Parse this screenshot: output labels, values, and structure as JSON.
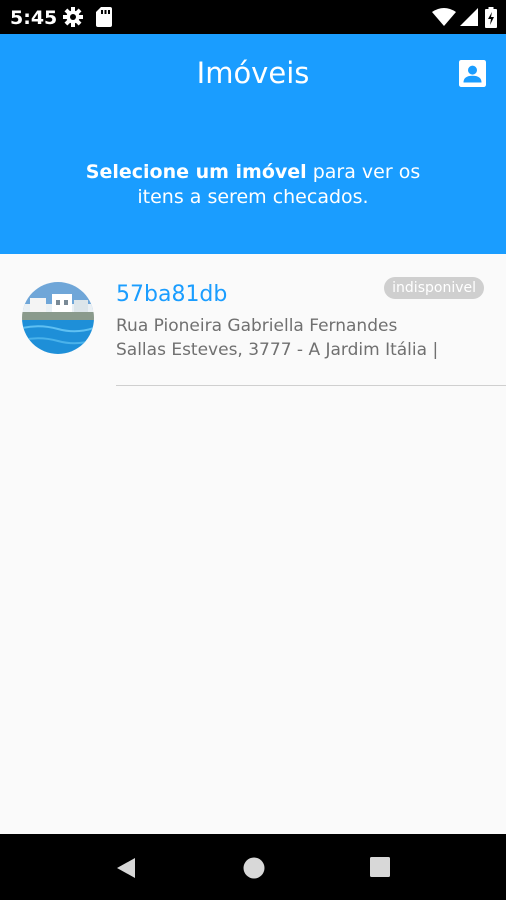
{
  "status_bar": {
    "time": "5:45",
    "icons": [
      "gear-icon",
      "sd-card-icon",
      "wifi-icon",
      "signal-icon",
      "battery-icon"
    ]
  },
  "header": {
    "title": "Imóveis",
    "subtitle_bold": "Selecione um imóvel",
    "subtitle_rest": " para ver os",
    "subtitle_line2": "itens a serem checados.",
    "background_color": "#1a9dff",
    "profile_icon": "account-box-icon"
  },
  "properties": [
    {
      "code": "57ba81db",
      "status": "indisponivel",
      "address_line1": "Rua Pioneira Gabriella Fernandes",
      "address_line2": "Sallas Esteves, 3777 - A Jardim Itália |",
      "thumbnail": "house-pool-photo"
    }
  ],
  "nav": {
    "back_icon": "back-triangle-icon",
    "home_icon": "home-circle-icon",
    "recents_icon": "recents-square-icon"
  }
}
